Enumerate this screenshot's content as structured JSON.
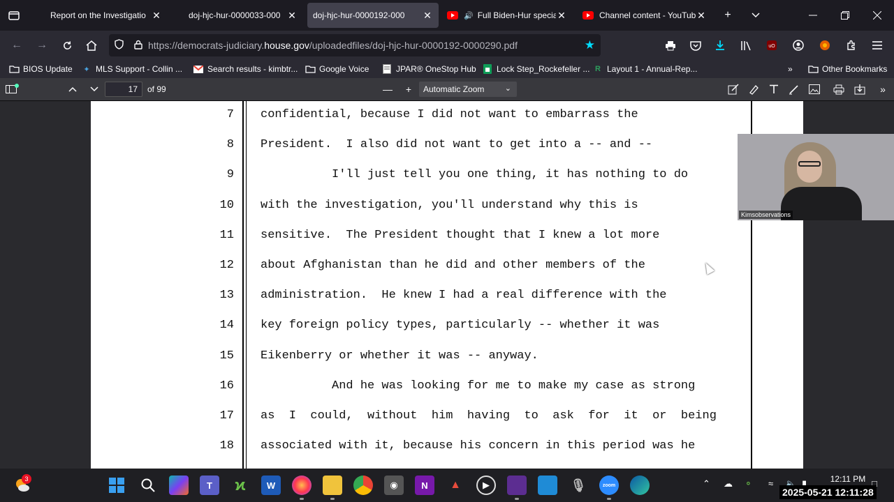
{
  "tabs": [
    {
      "title": "Report on the Investigatio",
      "active": false,
      "youtube": false
    },
    {
      "title": "doj-hjc-hur-0000033-000",
      "active": false,
      "youtube": false
    },
    {
      "title": "doj-hjc-hur-0000192-000",
      "active": true,
      "youtube": false
    },
    {
      "title": "Full Biden-Hur special",
      "active": false,
      "youtube": true,
      "audio": true
    },
    {
      "title": "Channel content - YouTub",
      "active": false,
      "youtube": true
    }
  ],
  "url": {
    "prefix": "https://democrats-judiciary.",
    "domain": "house.gov",
    "suffix": "/uploadedfiles/doj-hjc-hur-0000192-0000290.pdf"
  },
  "bookmarks": [
    {
      "label": "BIOS Update",
      "icon": "folder-icon"
    },
    {
      "label": "MLS Support - Collin ...",
      "icon": "star-logo-icon"
    },
    {
      "label": "Search results - kimbtr...",
      "icon": "gmail-icon"
    },
    {
      "label": "Google Voice",
      "icon": "folder-icon"
    },
    {
      "label": "JPAR® OneStop Hub",
      "icon": "document-icon"
    },
    {
      "label": "Lock Step_Rockefeller ...",
      "icon": "sheets-icon"
    },
    {
      "label": "Layout 1 - Annual-Rep...",
      "icon": "r-logo-icon"
    },
    {
      "label": "Other Bookmarks",
      "icon": "folder-icon"
    }
  ],
  "pdf": {
    "page_number": "17",
    "page_count_label": "of 99",
    "zoom": "Automatic Zoom"
  },
  "transcript": [
    {
      "line": "7",
      "text": "confidential, because I did not want to embarrass the"
    },
    {
      "line": "8",
      "text": "President.  I also did not want to get into a -- and --"
    },
    {
      "line": "9",
      "text": "          I'll just tell you one thing, it has nothing to do"
    },
    {
      "line": "10",
      "text": "with the investigation, you'll understand why this is"
    },
    {
      "line": "11",
      "text": "sensitive.  The President thought that I knew a lot more"
    },
    {
      "line": "12",
      "text": "about Afghanistan than he did and other members of the"
    },
    {
      "line": "13",
      "text": "administration.  He knew I had a real difference with the"
    },
    {
      "line": "14",
      "text": "key foreign policy types, particularly -- whether it was"
    },
    {
      "line": "15",
      "text": "Eikenberry or whether it was -- anyway."
    },
    {
      "line": "16",
      "text": "          And he was looking for me to make my case as strong"
    },
    {
      "line": "17",
      "text": "as  I  could,  without  him  having  to  ask  for  it  or  being"
    },
    {
      "line": "18",
      "text": "associated with it, because his concern in this period was he"
    }
  ],
  "webcam": {
    "label": "Kimsobservations"
  },
  "taskbar": {
    "weather_badge": "3",
    "time": "12:11 PM",
    "date_fragment": "2025-05-21",
    "stamp": "2025-05-21 12:11:28"
  },
  "colors": {
    "accent_star": "#00ddff",
    "youtube_red": "#ff0000",
    "download_icon": "#00ddff"
  }
}
